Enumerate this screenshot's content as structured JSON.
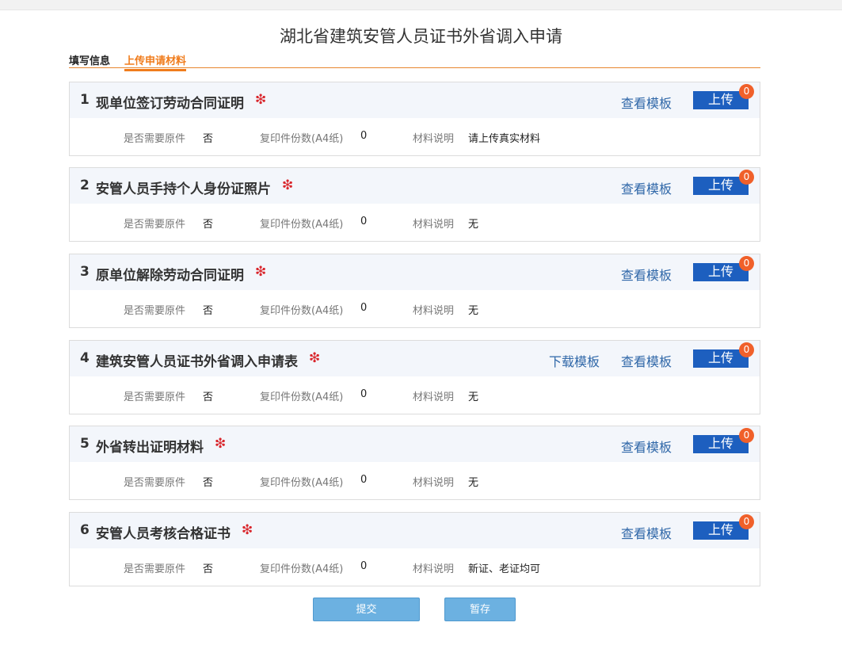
{
  "page": {
    "title": "湖北省建筑安管人员证书外省调入申请"
  },
  "tabs": {
    "fill": "填写信息",
    "upload": "上传申请材料"
  },
  "labels": {
    "original": "是否需要原件",
    "copies": "复印件份数(A4纸)",
    "note": "材料说明",
    "view_template": "查看模板",
    "download_template": "下载模板",
    "upload": "上传",
    "required_mark": "❇"
  },
  "materials": [
    {
      "num": "1",
      "title": "现单位签订劳动合同证明",
      "original": "否",
      "copies": "0",
      "note": "请上传真实材料",
      "count": "0"
    },
    {
      "num": "2",
      "title": "安管人员手持个人身份证照片",
      "original": "否",
      "copies": "0",
      "note": "无",
      "count": "0"
    },
    {
      "num": "3",
      "title": "原单位解除劳动合同证明",
      "original": "否",
      "copies": "0",
      "note": "无",
      "count": "0"
    },
    {
      "num": "4",
      "title": "建筑安管人员证书外省调入申请表",
      "original": "否",
      "copies": "0",
      "note": "无",
      "count": "0"
    },
    {
      "num": "5",
      "title": "外省转出证明材料",
      "original": "否",
      "copies": "0",
      "note": "无",
      "count": "0"
    },
    {
      "num": "6",
      "title": "安管人员考核合格证书",
      "original": "否",
      "copies": "0",
      "note": "新证、老证均可",
      "count": "0"
    }
  ],
  "actions": {
    "submit": "提交",
    "save": "暂存"
  },
  "colors": {
    "accent": "#f07c1c",
    "upload": "#1d5fbf",
    "badge": "#f0602a",
    "link": "#2f67a8",
    "required": "#d9252b"
  }
}
